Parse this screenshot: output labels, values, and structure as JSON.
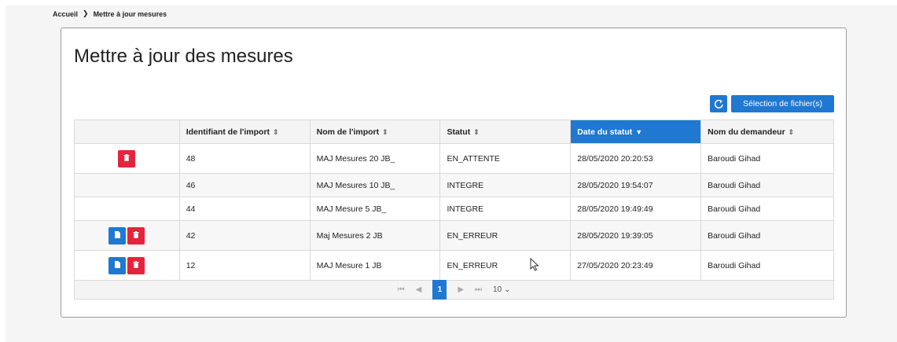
{
  "breadcrumb": {
    "home": "Accueil",
    "separator": "❯",
    "current": "Mettre à jour mesures"
  },
  "page": {
    "title": "Mettre à jour des mesures"
  },
  "toolbar": {
    "refresh_icon": "refresh-icon",
    "select_files_label": "Sélection de fichier(s)"
  },
  "table": {
    "headers": [
      "",
      "Identifiant de l'import",
      "Nom de l'import",
      "Statut",
      "Date du statut",
      "Nom du demandeur"
    ],
    "sort_icon": "⇕",
    "sorted_icon": "▼",
    "sorted_column": "Date du statut",
    "rows": [
      {
        "actions": [
          "delete"
        ],
        "id": "48",
        "name": "MAJ Mesures 20 JB_",
        "status": "EN_ATTENTE",
        "date": "28/05/2020 20:20:53",
        "requester": "Baroudi Gihad"
      },
      {
        "actions": [],
        "id": "46",
        "name": "MAJ Mesures 10 JB_",
        "status": "INTEGRE",
        "date": "28/05/2020 19:54:07",
        "requester": "Baroudi Gihad"
      },
      {
        "actions": [],
        "id": "44",
        "name": "MAJ Mesure 5 JB_",
        "status": "INTEGRE",
        "date": "28/05/2020 19:49:49",
        "requester": "Baroudi Gihad"
      },
      {
        "actions": [
          "document",
          "delete"
        ],
        "id": "42",
        "name": "Maj Mesures 2 JB",
        "status": "EN_ERREUR",
        "date": "28/05/2020 19:39:05",
        "requester": "Baroudi Gihad"
      },
      {
        "actions": [
          "document",
          "delete"
        ],
        "id": "12",
        "name": "MAJ Mesure 1 JB",
        "status": "EN_ERREUR",
        "date": "27/05/2020 20:23:49",
        "requester": "Baroudi Gihad"
      }
    ]
  },
  "pagination": {
    "first": "⏮",
    "prev": "◀",
    "current_page": "1",
    "next": "▶",
    "last": "⏭",
    "page_size": "10",
    "page_size_chevron": "⌄"
  },
  "colors": {
    "accent": "#1f78d1",
    "danger": "#e5233d"
  }
}
